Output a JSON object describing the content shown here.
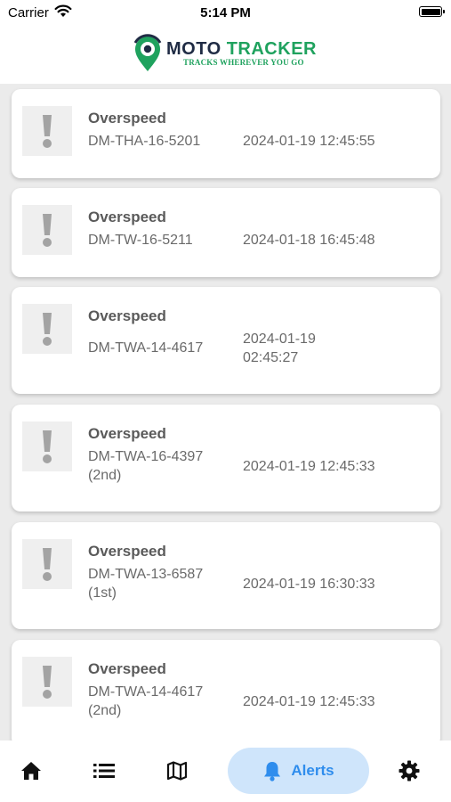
{
  "status_bar": {
    "carrier": "Carrier",
    "time": "5:14 PM"
  },
  "header": {
    "logo_moto": "MOTO",
    "logo_tracker": "TRACKER",
    "logo_tagline": "TRACKS WHEREVER YOU GO"
  },
  "alerts": [
    {
      "title": "Overspeed",
      "vehicle": "DM-THA-16-5201",
      "timestamp": "2024-01-19 12:45:55"
    },
    {
      "title": "Overspeed",
      "vehicle": "DM-TW-16-5211",
      "timestamp": "2024-01-18 16:45:48"
    },
    {
      "title": "Overspeed",
      "vehicle": "DM-TWA-14-4617",
      "timestamp": "2024-01-19 02:45:27"
    },
    {
      "title": "Overspeed",
      "vehicle": "DM-TWA-16-4397 (2nd)",
      "timestamp": "2024-01-19 12:45:33"
    },
    {
      "title": "Overspeed",
      "vehicle": "DM-TWA-13-6587 (1st)",
      "timestamp": "2024-01-19 16:30:33"
    },
    {
      "title": "Overspeed",
      "vehicle": "DM-TWA-14-4617 (2nd)",
      "timestamp": "2024-01-19 12:45:33"
    }
  ],
  "bottom_nav": {
    "items": [
      {
        "icon": "home-icon"
      },
      {
        "icon": "list-icon"
      },
      {
        "icon": "map-icon"
      },
      {
        "icon": "bell-icon",
        "label": "Alerts",
        "active": true
      },
      {
        "icon": "gear-icon"
      }
    ],
    "active_color": "#2f8ded",
    "active_bg": "#cfe5fb"
  },
  "colors": {
    "brand_dark": "#1f2b44",
    "brand_green": "#1fa25e",
    "list_bg": "#ebebeb"
  }
}
